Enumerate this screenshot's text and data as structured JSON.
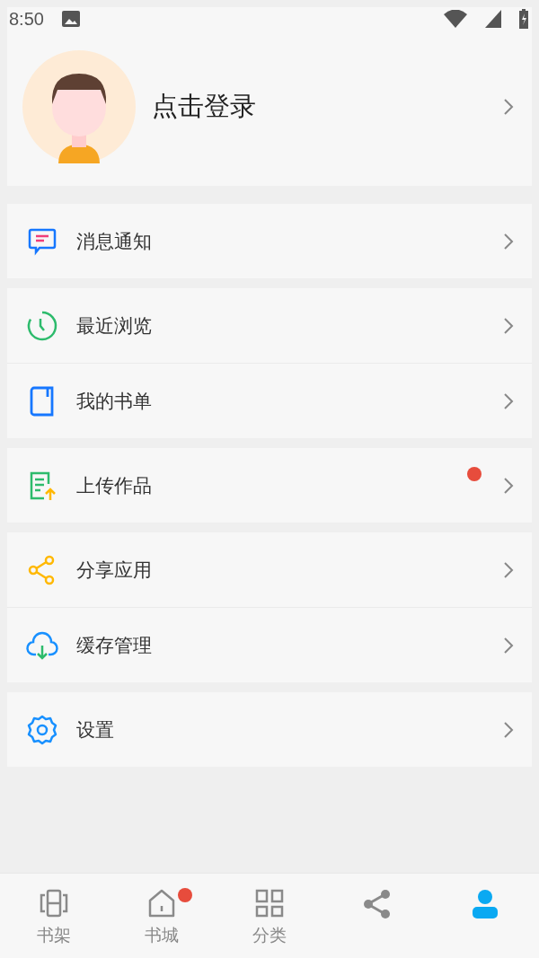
{
  "status_bar": {
    "time": "8:50"
  },
  "profile": {
    "title": "点击登录"
  },
  "menu_groups": [
    {
      "items": [
        {
          "kind": "message",
          "label": "消息通知",
          "badge": false
        }
      ]
    },
    {
      "items": [
        {
          "kind": "clock",
          "label": "最近浏览",
          "badge": false
        },
        {
          "kind": "book",
          "label": "我的书单",
          "badge": false
        }
      ]
    },
    {
      "items": [
        {
          "kind": "upload",
          "label": "上传作品",
          "badge": true
        }
      ]
    },
    {
      "items": [
        {
          "kind": "share",
          "label": "分享应用",
          "badge": false
        },
        {
          "kind": "cloud",
          "label": "缓存管理",
          "badge": false
        }
      ]
    },
    {
      "items": [
        {
          "kind": "gear",
          "label": "设置",
          "badge": false
        }
      ]
    }
  ],
  "bottom_nav": [
    {
      "kind": "shelf",
      "label": "书架",
      "badge": false,
      "selected": false
    },
    {
      "kind": "home",
      "label": "书城",
      "badge": true,
      "selected": false
    },
    {
      "kind": "grid",
      "label": "分类",
      "badge": false,
      "selected": false
    },
    {
      "kind": "share",
      "badge": false,
      "selected": false
    },
    {
      "kind": "person",
      "badge": false,
      "selected": true
    }
  ]
}
